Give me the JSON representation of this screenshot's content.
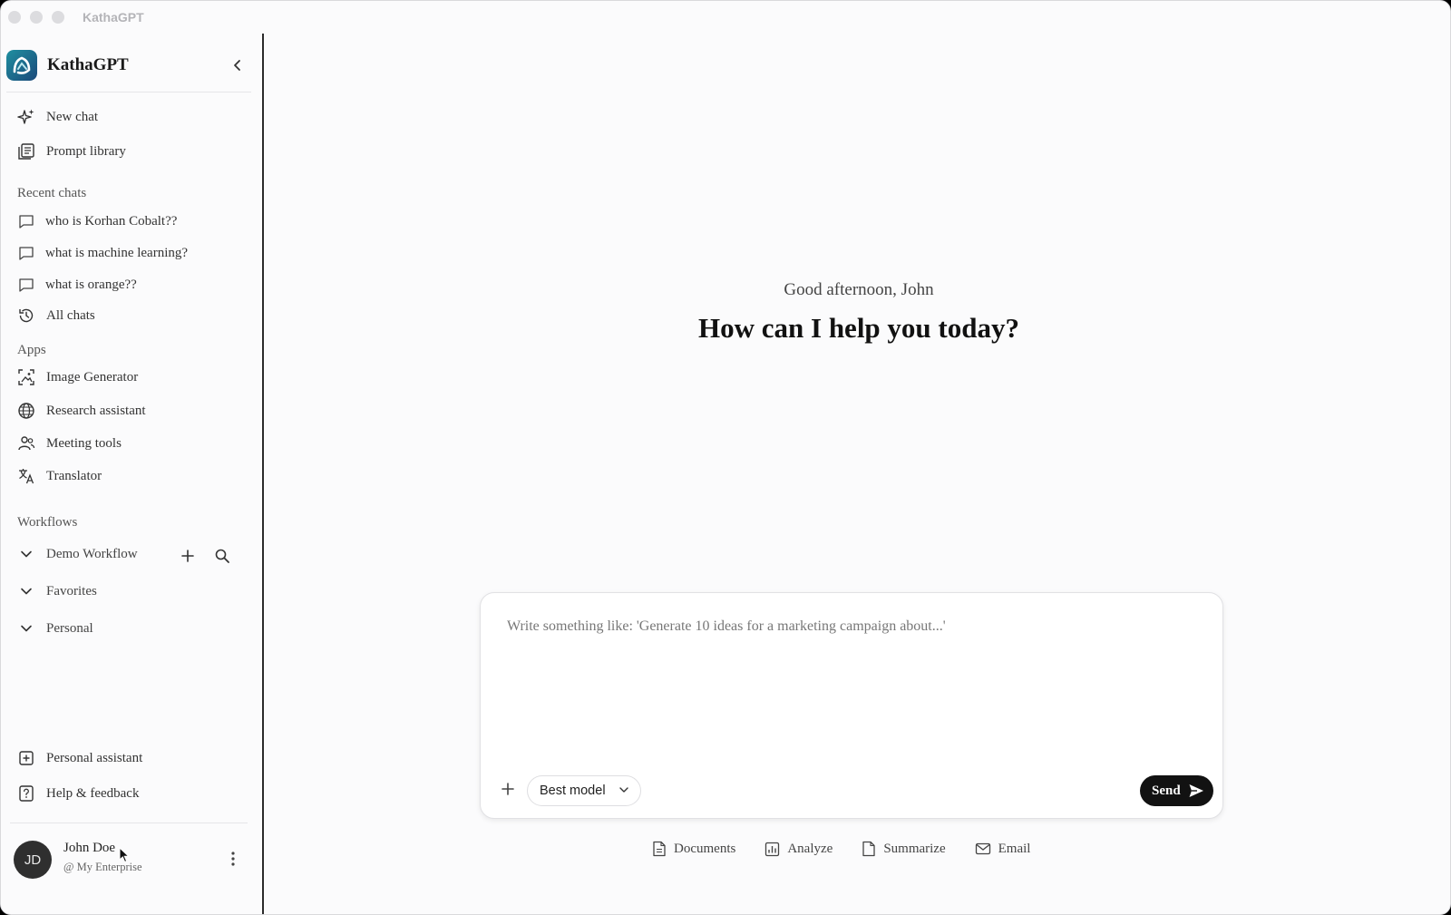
{
  "window": {
    "title": "KathaGPT"
  },
  "sidebar": {
    "brand": "KathaGPT",
    "primary": [
      {
        "label": "New chat",
        "icon": "sparkle-icon"
      },
      {
        "label": "Prompt library",
        "icon": "library-icon"
      }
    ],
    "recent_label": "Recent chats",
    "recent": [
      {
        "label": "who is Korhan Cobalt??"
      },
      {
        "label": "what is machine learning?"
      },
      {
        "label": "what is orange??"
      }
    ],
    "all_chats": "All chats",
    "apps_label": "Apps",
    "apps": [
      {
        "label": "Image Generator",
        "icon": "image-icon"
      },
      {
        "label": "Research assistant",
        "icon": "globe-icon"
      },
      {
        "label": "Meeting tools",
        "icon": "people-icon"
      },
      {
        "label": "Translator",
        "icon": "translate-icon"
      }
    ],
    "workflows_label": "Workflows",
    "workflows": [
      {
        "label": "Demo Workflow"
      },
      {
        "label": "Favorites"
      },
      {
        "label": "Personal"
      }
    ],
    "footer": [
      {
        "label": "Personal assistant",
        "icon": "plus-box-icon"
      },
      {
        "label": "Help & feedback",
        "icon": "help-icon"
      }
    ],
    "user": {
      "initials": "JD",
      "name": "John Doe",
      "org": "@ My Enterprise"
    }
  },
  "main": {
    "greeting": "Good afternoon, John",
    "headline": "How can I help you today?",
    "composer": {
      "placeholder": "Write something like: 'Generate 10 ideas for a marketing campaign about...'",
      "value": "",
      "model": "Best model",
      "send": "Send"
    },
    "quick_actions": [
      {
        "label": "Documents",
        "icon": "document-icon"
      },
      {
        "label": "Analyze",
        "icon": "chart-icon"
      },
      {
        "label": "Summarize",
        "icon": "summary-icon"
      },
      {
        "label": "Email",
        "icon": "mail-icon"
      }
    ]
  }
}
